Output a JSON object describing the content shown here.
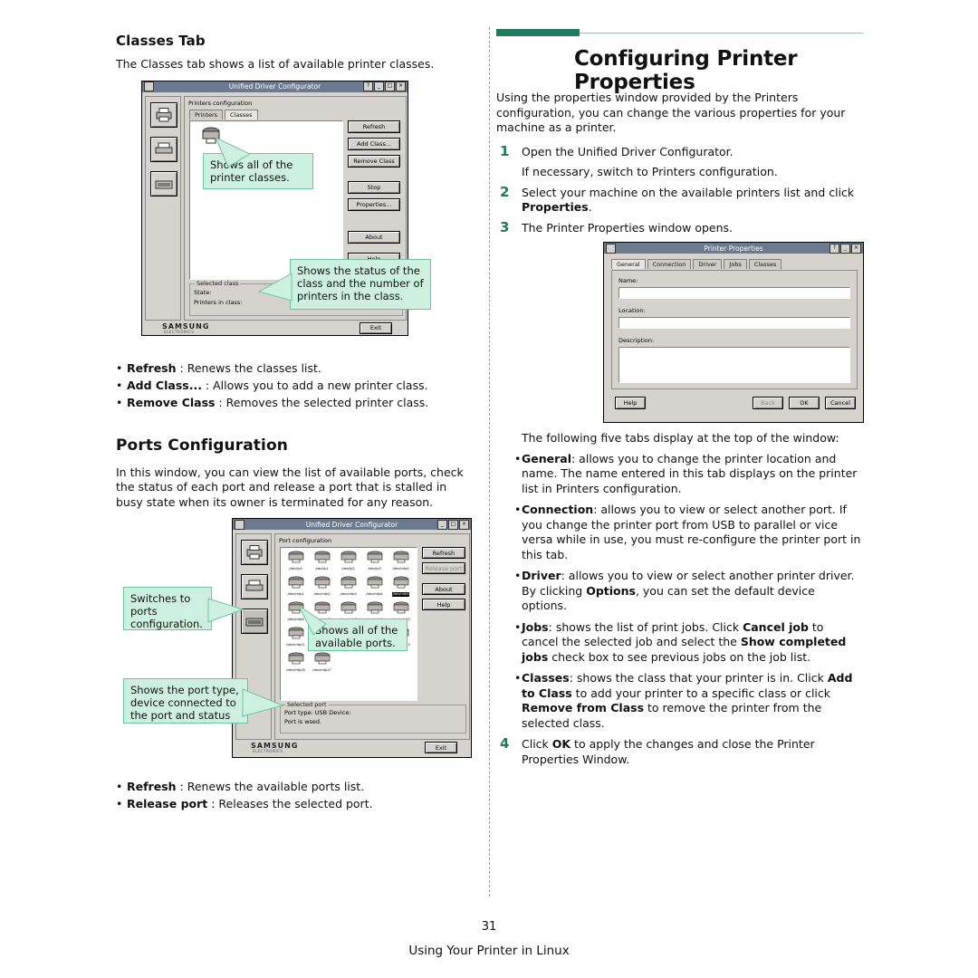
{
  "left": {
    "classes_tab": {
      "heading": "Classes Tab",
      "intro": "The Classes tab shows a list of available printer classes.",
      "bullets": [
        {
          "term": "Refresh",
          "sep": " : ",
          "desc": "Renews the classes list."
        },
        {
          "term": "Add Class...",
          "sep": " : ",
          "desc": "Allows you to add a new printer class."
        },
        {
          "term": "Remove Class",
          "sep": " : ",
          "desc": "Removes the selected printer class."
        }
      ],
      "window": {
        "title": "Unified Driver Configurator",
        "panel_title": "Printers configuration",
        "tabs": [
          "Printers",
          "Classes"
        ],
        "active_tab": "Classes",
        "buttons": [
          "Refresh",
          "Add Class...",
          "Remove Class",
          "Stop",
          "Properties...",
          "About",
          "Help"
        ],
        "status_group": "Selected class",
        "status_lines": [
          "State:",
          "Printers in class:"
        ],
        "exit_label": "Exit",
        "brand": "SAMSUNG",
        "brand_sub": "ELECTRONICS"
      },
      "callouts": [
        "Shows all of the\nprinter classes.",
        "Shows the status of the\nclass and the number of\nprinters in the class."
      ]
    },
    "ports_config": {
      "heading": "Ports Configuration",
      "intro": "In this window, you can view the list of available ports, check the status of each port and release a port that is stalled in busy state when its owner is terminated for any reason.",
      "bullets": [
        {
          "term": "Refresh",
          "sep": " : ",
          "desc": "Renews the available ports list."
        },
        {
          "term": "Release port",
          "sep": " : ",
          "desc": "Releases the selected port."
        }
      ],
      "window": {
        "title": "Unified Driver Configurator",
        "panel_title": "Port configuration",
        "buttons": [
          "Refresh",
          "Release port",
          "About",
          "Help"
        ],
        "ports": [
          "/dev/lp0",
          "/dev/lp1",
          "/dev/lp2",
          "/dev/lp3",
          "/dev/mfp0",
          "/dev/mfp1",
          "/dev/mfp2",
          "/dev/mfp3",
          "/dev/mfp4",
          "/dev/mfp5",
          "/dev/mfp6",
          "/dev/mfp7",
          "/dev/mfp8",
          "/dev/mfp9",
          "/dev/mfp10",
          "/dev/mfp11",
          "/dev/mfp12",
          "/dev/mfp13",
          "/dev/mfp14",
          "/dev/mfp15",
          "/dev/mfp16",
          "/dev/mfp17"
        ],
        "status_group": "Selected port",
        "status_lines": [
          "Port type: USB   Device:",
          "Port is wsed."
        ],
        "exit_label": "Exit",
        "brand": "SAMSUNG",
        "brand_sub": "ELECTRONICS"
      },
      "callouts": [
        "Switches to\nports\nconfiguration.",
        "Shows all of the\navailable ports.",
        "Shows the port type,\ndevice connected to\nthe port and status"
      ]
    }
  },
  "right": {
    "chapter_title": "Configuring Printer Properties",
    "intro": "Using the properties window provided by the Printers configuration, you can change the various properties for your machine as a printer.",
    "steps": [
      {
        "num": "1",
        "text": "Open the Unified Driver Configurator."
      },
      {
        "num": "",
        "text": "If necessary, switch to Printers configuration."
      },
      {
        "num": "2",
        "pre": "Select your machine on the available printers list and click ",
        "bold": "Properties",
        "post": "."
      },
      {
        "num": "3",
        "text": "The Printer Properties window opens."
      }
    ],
    "after_window_note": "The following five tabs display at the top of the window:",
    "tab_descriptions": [
      {
        "term": "General",
        "text": ": allows you to change the printer location and name. The name entered in this tab displays on the printer list in Printers configuration."
      },
      {
        "term": "Connection",
        "text": ": allows you to view or select another port. If you change the printer port from USB to parallel or vice versa while in use, you must re-configure the printer port in this tab."
      },
      {
        "term": "Driver",
        "text": ": allows you to view or select another printer driver. By clicking ",
        "bold2": "Options",
        "text2": ", you can set the default device options."
      },
      {
        "term": "Jobs",
        "text": ": shows the list of print jobs. Click ",
        "bold2": "Cancel job",
        "text2": " to cancel the selected job and select the ",
        "bold3": "Show completed jobs",
        "text3": " check box to see previous jobs on the job list."
      },
      {
        "term": "Classes",
        "text": ": shows the class that your printer is in. Click ",
        "bold2": "Add to Class",
        "text2": " to add your printer to a specific class or click ",
        "bold3": "Remove from Class",
        "text3": " to remove the printer from the selected class."
      }
    ],
    "final_step": {
      "num": "4",
      "pre": "Click ",
      "bold": "OK",
      "post": " to apply the changes and close the Printer Properties Window."
    },
    "window": {
      "title": "Printer Properties",
      "tabs": [
        "General",
        "Connection",
        "Driver",
        "Jobs",
        "Classes"
      ],
      "active_tab": "General",
      "fields": [
        {
          "label": "Name:",
          "value": ""
        },
        {
          "label": "Location:",
          "value": ""
        },
        {
          "label": "Description:",
          "value": ""
        }
      ],
      "buttons": [
        "Help",
        "Back",
        "OK",
        "Cancel"
      ]
    }
  },
  "footer": {
    "page_number": "31",
    "text": "Using Your Printer in Linux"
  },
  "colors": {
    "accent_green": "#1f7a5e",
    "callout_bg": "#cdf0e0",
    "callout_border": "#6ec3a2",
    "titlebar": "#6b7a8f",
    "window_face": "#d6d3ce"
  }
}
